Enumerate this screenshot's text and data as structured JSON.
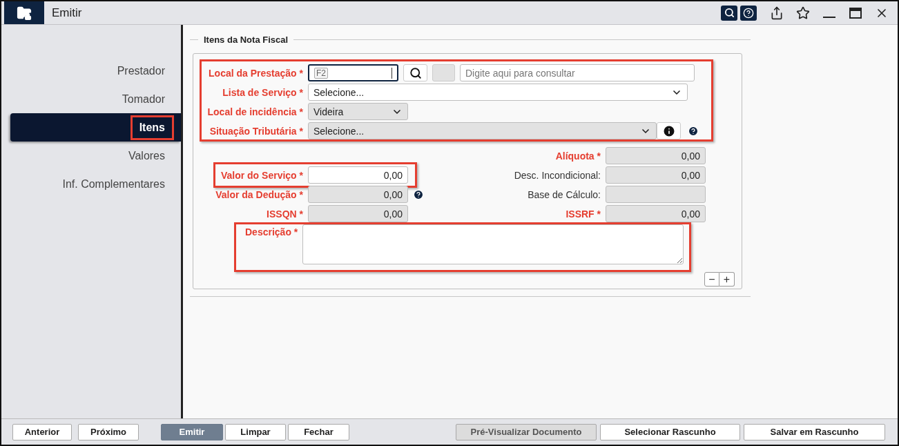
{
  "window": {
    "title": "Emitir"
  },
  "sidebar": {
    "items": [
      {
        "label": "Prestador",
        "selected": false,
        "highlighted": false
      },
      {
        "label": "Tomador",
        "selected": false,
        "highlighted": false
      },
      {
        "label": "Itens",
        "selected": true,
        "highlighted": true
      },
      {
        "label": "Valores",
        "selected": false,
        "highlighted": false
      },
      {
        "label": "Inf. Complementares",
        "selected": false,
        "highlighted": false
      }
    ]
  },
  "section": {
    "title": "Itens da Nota Fiscal",
    "service_group": {
      "highlighted": true,
      "fields": [
        {
          "kind": "lookup",
          "label": "Local da Prestação *",
          "required": true,
          "key_hint": "F2",
          "placeholder": "Digite aqui para consultar"
        },
        {
          "kind": "select",
          "label": "Lista de Serviço *",
          "required": true,
          "value": "Selecione...",
          "disabled": false
        },
        {
          "kind": "short_select",
          "label": "Local de incidência *",
          "required": true,
          "value": "Videira",
          "disabled": true
        },
        {
          "kind": "info_select",
          "label": "Situação Tributária *",
          "required": true,
          "value": "Selecione...",
          "disabled": true,
          "help": true
        }
      ]
    },
    "value_rows": [
      {
        "right": {
          "label": "Alíquota *",
          "required": true,
          "value": "0,00",
          "disabled": true
        }
      },
      {
        "left": {
          "label": "Valor do Serviço *",
          "required": true,
          "value": "0,00",
          "disabled": false,
          "highlighted": true
        },
        "right": {
          "label": "Desc. Incondicional:",
          "required": false,
          "value": "0,00",
          "disabled": true
        }
      },
      {
        "left": {
          "label": "Valor da Dedução *",
          "required": true,
          "value": "0,00",
          "disabled": true,
          "help": true
        },
        "right": {
          "label": "Base de Cálculo:",
          "required": false,
          "disabled": true
        }
      },
      {
        "left": {
          "label": "ISSQN *",
          "required": true,
          "value": "0,00",
          "disabled": true
        },
        "right": {
          "label": "ISSRF *",
          "required": true,
          "value": "0,00",
          "disabled": true
        }
      }
    ],
    "description": {
      "label": "Descrição *",
      "required": true,
      "highlighted": true
    },
    "item_buttons": [
      "−",
      "+"
    ]
  },
  "footer": {
    "nav_buttons": [
      {
        "label": "Anterior",
        "kind": "default",
        "disabled": false
      },
      {
        "label": "Próximo",
        "kind": "default",
        "disabled": false
      }
    ],
    "action_buttons": [
      {
        "label": "Emitir",
        "kind": "primary",
        "disabled": true
      },
      {
        "label": "Limpar",
        "kind": "default",
        "disabled": false
      },
      {
        "label": "Fechar",
        "kind": "default",
        "disabled": false
      }
    ],
    "draft_buttons": [
      {
        "label": "Pré-Visualizar Documento",
        "kind": "default",
        "disabled": true
      },
      {
        "label": "Selecionar Rascunho",
        "kind": "default",
        "disabled": false
      },
      {
        "label": "Salvar em Rascunho",
        "kind": "default",
        "disabled": false
      }
    ]
  }
}
